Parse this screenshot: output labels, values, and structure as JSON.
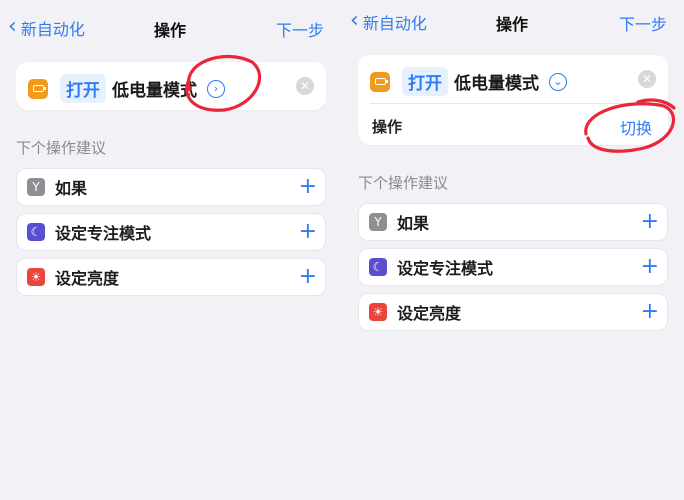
{
  "left": {
    "nav": {
      "back_label": "新自动化",
      "title": "操作",
      "next_label": "下一步"
    },
    "action": {
      "icon": "battery-icon",
      "verb": "打开",
      "parameter": "低电量模式",
      "expand_icon": "chevron-right-circle-icon",
      "clear_icon": "clear-icon"
    },
    "section_title": "下个操作建议",
    "suggestions": [
      {
        "label": "如果",
        "icon": "branch-icon"
      },
      {
        "label": "设定专注模式",
        "icon": "moon-icon"
      },
      {
        "label": "设定亮度",
        "icon": "sun-icon"
      }
    ]
  },
  "right": {
    "nav": {
      "back_label": "新自动化",
      "title": "操作",
      "next_label": "下一步"
    },
    "action": {
      "icon": "battery-icon",
      "verb": "打开",
      "parameter": "低电量模式",
      "expand_icon": "chevron-down-circle-icon",
      "clear_icon": "clear-icon"
    },
    "operation": {
      "label": "操作",
      "value": "切换"
    },
    "section_title": "下个操作建议",
    "suggestions": [
      {
        "label": "如果",
        "icon": "branch-icon"
      },
      {
        "label": "设定专注模式",
        "icon": "moon-icon"
      },
      {
        "label": "设定亮度",
        "icon": "sun-icon"
      }
    ]
  },
  "colors": {
    "accent": "#2f7bf3",
    "battery": "#f19a1c",
    "annotation": "#e8283a"
  }
}
